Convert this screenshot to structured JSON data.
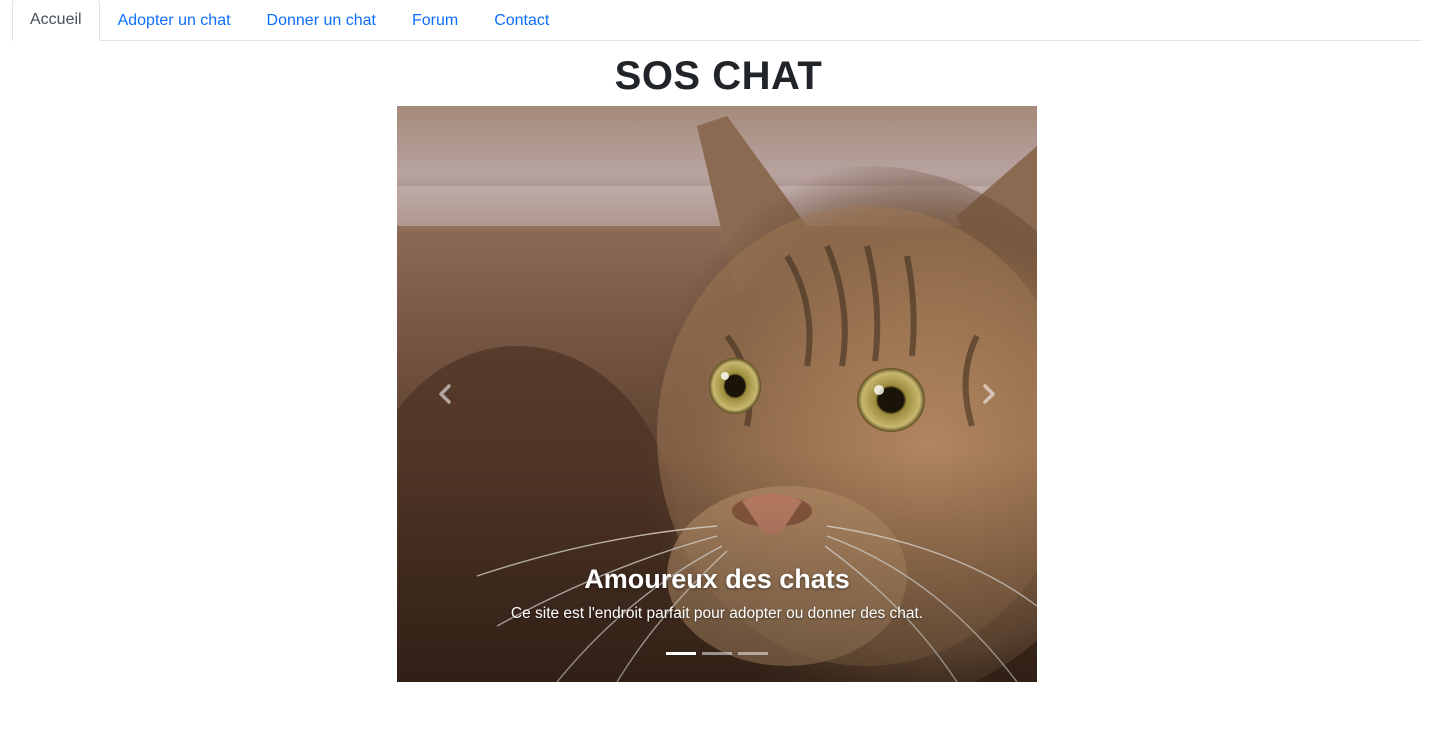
{
  "nav": {
    "tabs": [
      {
        "label": "Accueil",
        "active": true
      },
      {
        "label": "Adopter un chat",
        "active": false
      },
      {
        "label": "Donner un chat",
        "active": false
      },
      {
        "label": "Forum",
        "active": false
      },
      {
        "label": "Contact",
        "active": false
      }
    ]
  },
  "page": {
    "title": "SOS CHAT"
  },
  "carousel": {
    "slide": {
      "image": "tabby-cat-photo",
      "caption_title": "Amoureux des chats",
      "caption_text": "Ce site est l'endroit parfait pour adopter ou donner des chat."
    },
    "prev_icon": "chevron-left-icon",
    "next_icon": "chevron-right-icon",
    "indicator_count": 3,
    "active_indicator": 1
  },
  "colors": {
    "link": "#0d6efd",
    "active_tab_text": "#495057",
    "title": "#212529",
    "border": "#dee2e6"
  }
}
